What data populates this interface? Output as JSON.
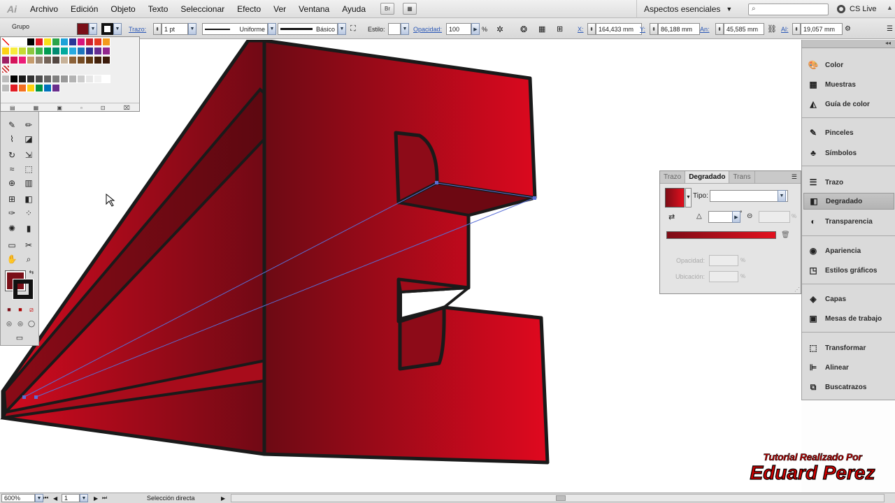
{
  "app": {
    "logo": "Ai"
  },
  "menu": [
    "Archivo",
    "Edición",
    "Objeto",
    "Texto",
    "Seleccionar",
    "Efecto",
    "Ver",
    "Ventana",
    "Ayuda"
  ],
  "menubar_buttons": [
    "Br",
    "▦"
  ],
  "workspace": "Aspectos esenciales",
  "cslive": "CS Live",
  "control": {
    "selection_label": "Grupo",
    "stroke_label": "Trazo:",
    "stroke_weight": "1 pt",
    "stroke_profile": "Uniforme",
    "brush": "Básico",
    "style_label": "Estilo:",
    "opacity_label": "Opacidad:",
    "opacity": "100",
    "percent": "%",
    "x_label": "X:",
    "x": "164,433 mm",
    "y_label": "Y:",
    "y": "86,188 mm",
    "w_label": "An:",
    "w": "45,585 mm",
    "h_label": "Al:",
    "h": "19,057 mm"
  },
  "gradient_panel": {
    "tabs": [
      "Trazo",
      "Degradado",
      "Trans"
    ],
    "type_label": "Tipo:",
    "opacity_label": "Opacidad:",
    "location_label": "Ubicación:",
    "degree": "°",
    "pct": "%",
    "colors": {
      "start": "#7d0c16",
      "end": "#e3101e"
    }
  },
  "dock": {
    "items": [
      {
        "label": "Color",
        "icon": "color-icon"
      },
      {
        "label": "Muestras",
        "icon": "swatches-icon"
      },
      {
        "label": "Guía de color",
        "icon": "color-guide-icon"
      },
      {
        "label": "Pinceles",
        "icon": "brushes-icon"
      },
      {
        "label": "Símbolos",
        "icon": "symbols-icon"
      },
      {
        "label": "Trazo",
        "icon": "stroke-icon"
      },
      {
        "label": "Degradado",
        "icon": "gradient-icon"
      },
      {
        "label": "Transparencia",
        "icon": "transparency-icon"
      },
      {
        "label": "Apariencia",
        "icon": "appearance-icon"
      },
      {
        "label": "Estilos gráficos",
        "icon": "graphic-styles-icon"
      },
      {
        "label": "Capas",
        "icon": "layers-icon"
      },
      {
        "label": "Mesas de trabajo",
        "icon": "artboards-icon"
      },
      {
        "label": "Transformar",
        "icon": "transform-icon"
      },
      {
        "label": "Alinear",
        "icon": "align-icon"
      },
      {
        "label": "Buscatrazos",
        "icon": "pathfinder-icon"
      }
    ]
  },
  "status": {
    "zoom": "600%",
    "artboard": "1",
    "tool": "Selección directa"
  },
  "watermark": {
    "line1": "Tutorial Realizado Por",
    "line2": "Eduard Perez"
  },
  "colors": {
    "fill": "#7a0f18",
    "letter_dark": "#6f0a14",
    "letter_bright": "#dc0a20",
    "outline": "#1a1a1a",
    "path_selection": "#5b6fd6"
  }
}
